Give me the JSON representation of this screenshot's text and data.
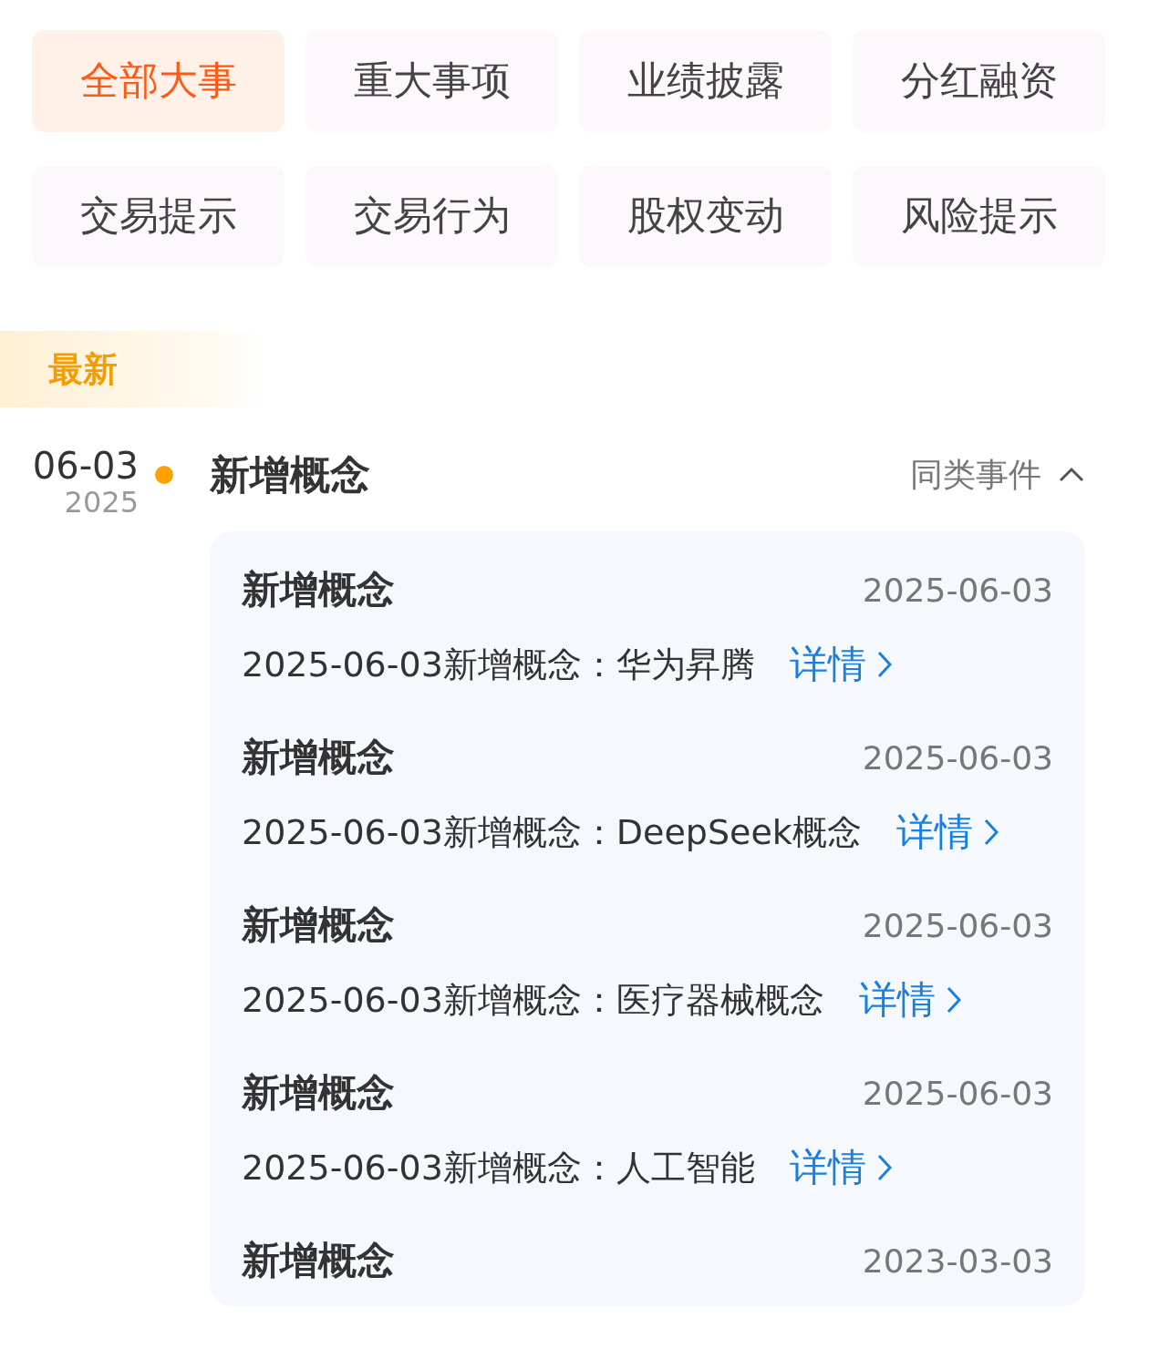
{
  "filters": [
    {
      "label": "全部大事",
      "selected": true
    },
    {
      "label": "重大事项",
      "selected": false
    },
    {
      "label": "业绩披露",
      "selected": false
    },
    {
      "label": "分红融资",
      "selected": false
    },
    {
      "label": "交易提示",
      "selected": false
    },
    {
      "label": "交易行为",
      "selected": false
    },
    {
      "label": "股权变动",
      "selected": false
    },
    {
      "label": "风险提示",
      "selected": false
    }
  ],
  "section_label": "最新",
  "events": [
    {
      "date": "06-03",
      "year": "2025",
      "title": "新增概念",
      "related_label": "同类事件",
      "expanded": true,
      "items": [
        {
          "title": "新增概念",
          "date": "2025-06-03",
          "text": "2025-06-03新增概念：华为昇腾",
          "link": "详情"
        },
        {
          "title": "新增概念",
          "date": "2025-06-03",
          "text": "2025-06-03新增概念：DeepSeek概念",
          "link": "详情"
        },
        {
          "title": "新增概念",
          "date": "2025-06-03",
          "text": "2025-06-03新增概念：医疗器械概念",
          "link": "详情"
        },
        {
          "title": "新增概念",
          "date": "2025-06-03",
          "text": "2025-06-03新增概念：人工智能",
          "link": "详情"
        },
        {
          "title": "新增概念",
          "date": "2023-03-03"
        }
      ]
    }
  ]
}
